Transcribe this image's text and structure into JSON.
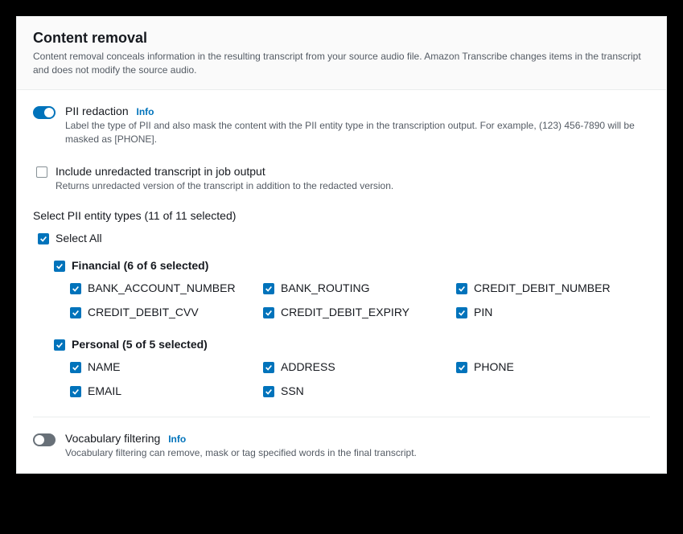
{
  "header": {
    "title": "Content removal",
    "description": "Content removal conceals information in the resulting transcript from your source audio file. Amazon Transcribe changes items in the transcript and does not modify the source audio."
  },
  "pii_redaction": {
    "label": "PII redaction",
    "info": "Info",
    "description": "Label the type of PII and also mask the content with the PII entity type in the transcription output. For example, (123) 456-7890 will be masked as [PHONE].",
    "enabled": true
  },
  "include_unredacted": {
    "label": "Include unredacted transcript in job output",
    "description": "Returns unredacted version of the transcript in addition to the redacted version.",
    "checked": false
  },
  "select_types_label": "Select PII entity types (11 of 11 selected)",
  "select_all": {
    "label": "Select All",
    "checked": true
  },
  "groups": [
    {
      "label": "Financial (6 of 6 selected)",
      "checked": true,
      "items": [
        {
          "label": "BANK_ACCOUNT_NUMBER",
          "checked": true
        },
        {
          "label": "BANK_ROUTING",
          "checked": true
        },
        {
          "label": "CREDIT_DEBIT_NUMBER",
          "checked": true
        },
        {
          "label": "CREDIT_DEBIT_CVV",
          "checked": true
        },
        {
          "label": "CREDIT_DEBIT_EXPIRY",
          "checked": true
        },
        {
          "label": "PIN",
          "checked": true
        }
      ]
    },
    {
      "label": "Personal (5 of 5 selected)",
      "checked": true,
      "items": [
        {
          "label": "NAME",
          "checked": true
        },
        {
          "label": "ADDRESS",
          "checked": true
        },
        {
          "label": "PHONE",
          "checked": true
        },
        {
          "label": "EMAIL",
          "checked": true
        },
        {
          "label": "SSN",
          "checked": true
        }
      ]
    }
  ],
  "vocab_filtering": {
    "label": "Vocabulary filtering",
    "info": "Info",
    "description": "Vocabulary filtering can remove, mask or tag specified words in the final transcript.",
    "enabled": false
  }
}
